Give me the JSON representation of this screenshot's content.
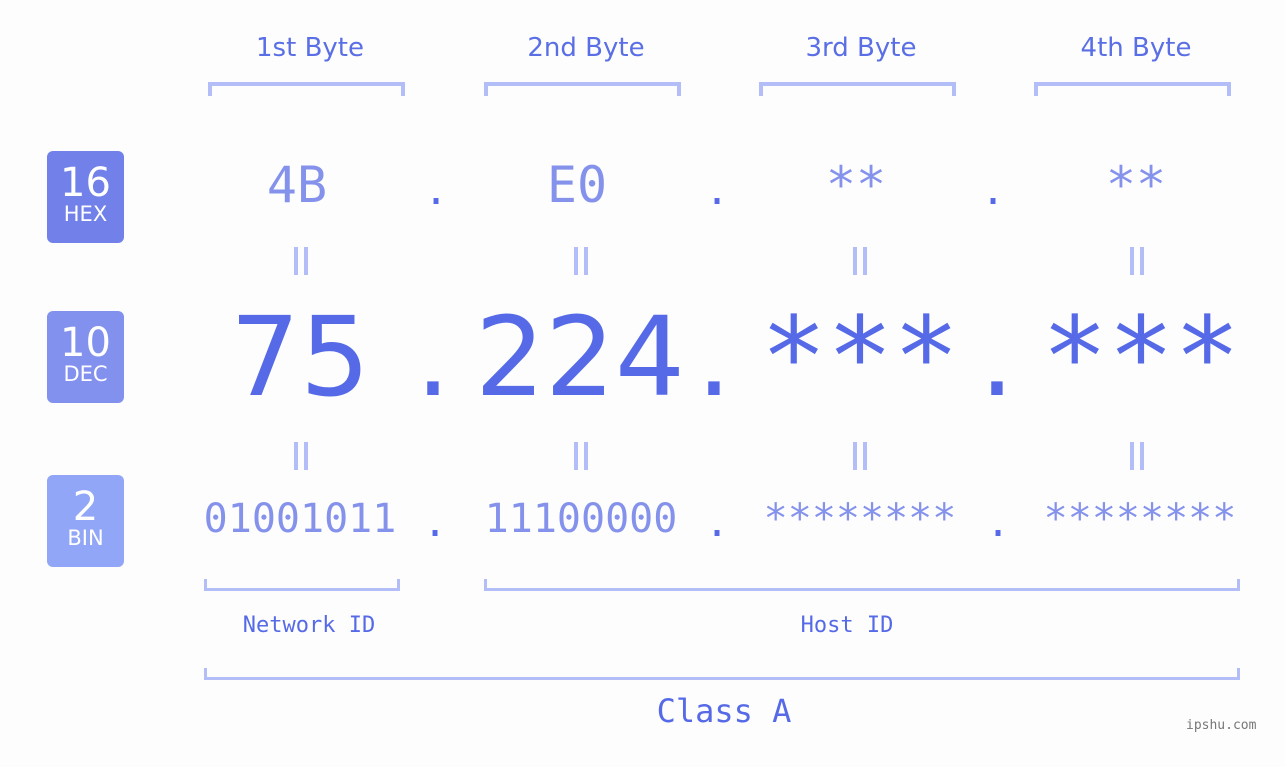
{
  "byte_headers": [
    "1st Byte",
    "2nd Byte",
    "3rd Byte",
    "4th Byte"
  ],
  "badges": [
    {
      "num": "16",
      "label": "HEX",
      "color": "#7281ea"
    },
    {
      "num": "10",
      "label": "DEC",
      "color": "#8391ee"
    },
    {
      "num": "2",
      "label": "BIN",
      "color": "#91a6f6"
    }
  ],
  "hex": [
    "4B",
    "E0",
    "**",
    "**"
  ],
  "dec": [
    "75",
    "224",
    "***",
    "***"
  ],
  "bin": [
    "01001011",
    "11100000",
    "********",
    "********"
  ],
  "separator": ".",
  "network_id_label": "Network ID",
  "host_id_label": "Host ID",
  "class_label": "Class A",
  "watermark": "ipshu.com",
  "colors": {
    "accent": "#566ae8",
    "light": "#8592ec",
    "bracket": "#b3bdf7"
  }
}
